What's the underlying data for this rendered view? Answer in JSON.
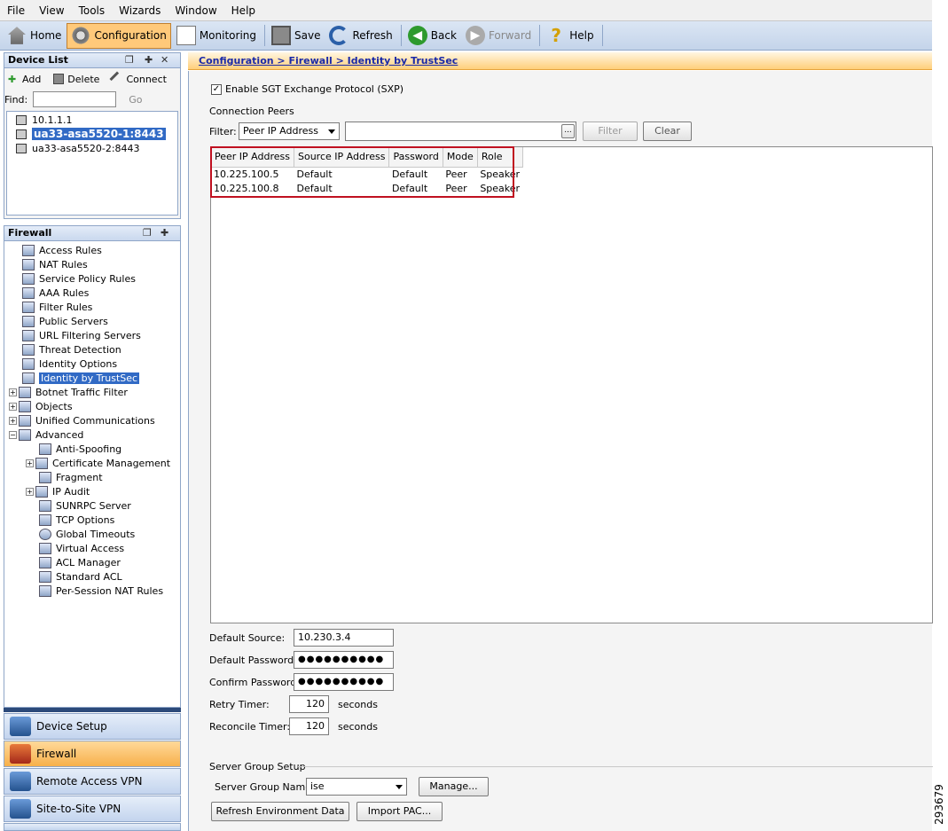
{
  "menu": [
    "File",
    "View",
    "Tools",
    "Wizards",
    "Window",
    "Help"
  ],
  "toolbar": {
    "home": "Home",
    "configuration": "Configuration",
    "monitoring": "Monitoring",
    "save": "Save",
    "refresh": "Refresh",
    "back": "Back",
    "forward": "Forward",
    "help": "Help"
  },
  "device_list": {
    "title": "Device List",
    "add": "Add",
    "delete": "Delete",
    "connect": "Connect",
    "find_label": "Find:",
    "go": "Go",
    "devices": [
      "10.1.1.1",
      "ua33-asa5520-1:8443",
      "ua33-asa5520-2:8443"
    ]
  },
  "firewall_panel": {
    "title": "Firewall",
    "items": [
      "Access Rules",
      "NAT Rules",
      "Service Policy Rules",
      "AAA Rules",
      "Filter Rules",
      "Public Servers",
      "URL Filtering Servers",
      "Threat Detection",
      "Identity Options",
      "Identity by TrustSec",
      "Botnet Traffic Filter",
      "Objects",
      "Unified Communications",
      "Advanced",
      "Anti-Spoofing",
      "Certificate Management",
      "Fragment",
      "IP Audit",
      "SUNRPC Server",
      "TCP Options",
      "Global Timeouts",
      "Virtual Access",
      "ACL Manager",
      "Standard ACL",
      "Per-Session NAT Rules"
    ]
  },
  "nav": {
    "device_setup": "Device Setup",
    "firewall": "Firewall",
    "remote_access_vpn": "Remote Access VPN",
    "site_to_site_vpn": "Site-to-Site VPN"
  },
  "breadcrumb": "Configuration > Firewall > Identity by TrustSec",
  "sxp": {
    "enable_label": "Enable SGT Exchange Protocol (SXP)",
    "enabled": true,
    "connection_peers": "Connection Peers",
    "filter_label": "Filter:",
    "filter_field": "Peer IP Address",
    "filter_button": "Filter",
    "clear_button": "Clear",
    "ellipsis": "..."
  },
  "peers_table": {
    "columns": [
      "Peer IP Address",
      "Source IP Address",
      "Password",
      "Mode",
      "Role"
    ],
    "rows": [
      [
        "10.225.100.5",
        "Default",
        "Default",
        "Peer",
        "Speaker"
      ],
      [
        "10.225.100.8",
        "Default",
        "Default",
        "Peer",
        "Speaker"
      ]
    ]
  },
  "settings": {
    "default_source_label": "Default Source:",
    "default_source_value": "10.230.3.4",
    "default_password_label": "Default Password:",
    "default_password_value": "●●●●●●●●●●",
    "confirm_password_label": "Confirm Password:",
    "confirm_password_value": "●●●●●●●●●●",
    "retry_timer_label": "Retry Timer:",
    "retry_timer_value": "120",
    "reconcile_timer_label": "Reconcile Timer:",
    "reconcile_timer_value": "120",
    "seconds": "seconds"
  },
  "server_group": {
    "title": "Server Group Setup",
    "name_label": "Server Group Name:",
    "name_value": "ise",
    "manage_button": "Manage...",
    "refresh_env_button": "Refresh Environment Data",
    "import_pac_button": "Import PAC..."
  },
  "figure_number": "293679"
}
